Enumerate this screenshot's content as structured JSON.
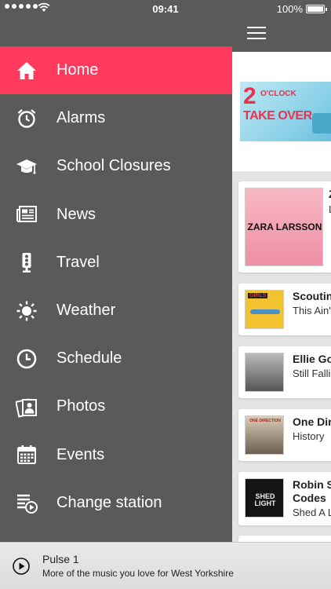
{
  "status_bar": {
    "time": "09:41",
    "battery": "100%"
  },
  "menu": {
    "items": [
      {
        "label": "Home",
        "icon": "home-icon",
        "active": true
      },
      {
        "label": "Alarms",
        "icon": "alarm-clock-icon",
        "active": false
      },
      {
        "label": "School Closures",
        "icon": "graduation-cap-icon",
        "active": false
      },
      {
        "label": "News",
        "icon": "newspaper-icon",
        "active": false
      },
      {
        "label": "Travel",
        "icon": "traffic-light-icon",
        "active": false
      },
      {
        "label": "Weather",
        "icon": "sun-icon",
        "active": false
      },
      {
        "label": "Schedule",
        "icon": "clock-icon",
        "active": false
      },
      {
        "label": "Photos",
        "icon": "photos-icon",
        "active": false
      },
      {
        "label": "Events",
        "icon": "calendar-icon",
        "active": false
      },
      {
        "label": "Change station",
        "icon": "change-station-icon",
        "active": false
      }
    ]
  },
  "banner": {
    "line1": "2",
    "line2": "O'CLOCK",
    "line3": "TAKE OVER"
  },
  "songs": [
    {
      "title": "Z",
      "artist": "L",
      "art_text": "ZARA LARSSON"
    },
    {
      "title": "Scoutin",
      "artist": "This Ain't",
      "art_text": "GIRLS"
    },
    {
      "title": "Ellie Go",
      "artist": "Still Fallin",
      "art_text": ""
    },
    {
      "title": "One Dire",
      "artist": "History",
      "art_text": "ONE DIRECTION"
    },
    {
      "title": "Robin S",
      "title2": "Codes",
      "artist": "Shed A L",
      "art_text": "SHED LIGHT"
    }
  ],
  "player": {
    "station": "Pulse 1",
    "tagline": "More of the music you love for West Yorkshire"
  },
  "colors": {
    "accent": "#ff3a5c",
    "drawer": "#5a5a5a",
    "background": "#e4e4e4"
  }
}
